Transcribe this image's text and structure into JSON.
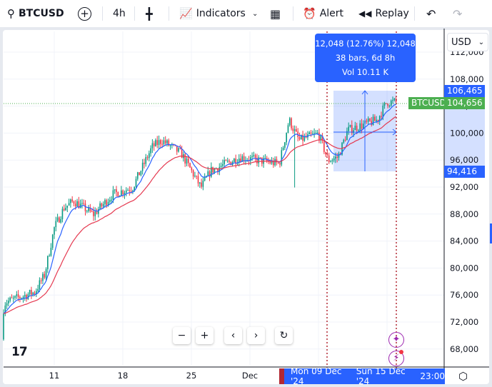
{
  "toolbar": {
    "symbol": "BTCUSD",
    "interval": "4h",
    "indicators": "Indicators",
    "alert": "Alert",
    "replay": "Replay"
  },
  "currency": "USD",
  "measure": {
    "line1": "12,048 (12.76%) 12,048",
    "line2": "38 bars, 6d 8h",
    "line3": "Vol 10.11 K",
    "high": "106,465",
    "low": "94,416"
  },
  "last_price": {
    "symbol": "BTCUSD",
    "price": "104,656"
  },
  "time_range": {
    "start": "Mon 09 Dec '24",
    "end": "Sun 15 Dec '24",
    "time": "23:00"
  },
  "colors": {
    "up": "#089981",
    "down": "#f23645",
    "ma_fast": "#2962ff",
    "ma_slow": "#e53950",
    "accent": "#2962ff",
    "last": "#4caf50"
  },
  "chart_data": {
    "type": "candlestick",
    "y_ticks": [
      "112,000",
      "108,000",
      "104,000",
      "100,000",
      "96,000",
      "92,000",
      "88,000",
      "84,000",
      "80,000",
      "76,000",
      "72,000",
      "68,000"
    ],
    "x_ticks": [
      "11",
      "18",
      "25",
      "Dec"
    ],
    "ylim": [
      66000,
      114000
    ],
    "approx_close_path": [
      [
        "Nov 05",
        69500
      ],
      [
        "Nov 06",
        75000
      ],
      [
        "Nov 09",
        76500
      ],
      [
        "Nov 10",
        79000
      ],
      [
        "Nov 11",
        86000
      ],
      [
        "Nov 12",
        89000
      ],
      [
        "Nov 13",
        90000
      ],
      [
        "Nov 15",
        88000
      ],
      [
        "Nov 17",
        91000
      ],
      [
        "Nov 19",
        92000
      ],
      [
        "Nov 21",
        98000
      ],
      [
        "Nov 22",
        99000
      ],
      [
        "Nov 24",
        97000
      ],
      [
        "Nov 26",
        92000
      ],
      [
        "Nov 27",
        94500
      ],
      [
        "Nov 30",
        96500
      ],
      [
        "Dec 02",
        96000
      ],
      [
        "Dec 04",
        95500
      ],
      [
        "Dec 05",
        102000
      ],
      [
        "Dec 06",
        99000
      ],
      [
        "Dec 08",
        100000
      ],
      [
        "Dec 09",
        96000
      ],
      [
        "Dec 10",
        96500
      ],
      [
        "Dec 11",
        100500
      ],
      [
        "Dec 13",
        101500
      ],
      [
        "Dec 14",
        102000
      ],
      [
        "Dec 15",
        104656
      ]
    ]
  }
}
